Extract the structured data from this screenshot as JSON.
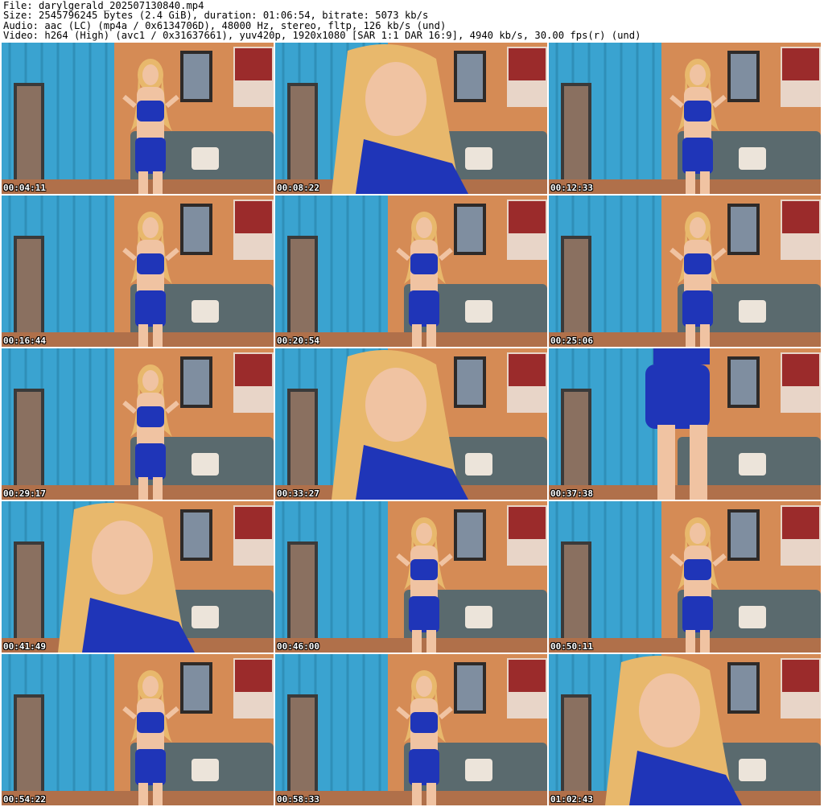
{
  "header": {
    "file": "File: darylgerald_202507130840.mp4",
    "size": "Size: 2545796245 bytes (2.4 GiB), duration: 01:06:54, bitrate: 5073 kb/s",
    "audio": "Audio: aac (LC) (mp4a / 0x6134706D), 48000 Hz, stereo, fltp, 126 kb/s (und)",
    "video": "Video: h264 (High) (avc1 / 0x31637661), yuv420p, 1920x1080 [SAR 1:1 DAR 16:9], 4940 kb/s, 30.00 fps(r) (und)"
  },
  "thumbnails": [
    {
      "timestamp": "00:04:11",
      "shot": "wide"
    },
    {
      "timestamp": "00:08:22",
      "shot": "closeup"
    },
    {
      "timestamp": "00:12:33",
      "shot": "wide"
    },
    {
      "timestamp": "00:16:44",
      "shot": "wide"
    },
    {
      "timestamp": "00:20:54",
      "shot": "wide"
    },
    {
      "timestamp": "00:25:06",
      "shot": "wide"
    },
    {
      "timestamp": "00:29:17",
      "shot": "wide"
    },
    {
      "timestamp": "00:33:27",
      "shot": "closeup"
    },
    {
      "timestamp": "00:37:38",
      "shot": "legs"
    },
    {
      "timestamp": "00:41:49",
      "shot": "closeup"
    },
    {
      "timestamp": "00:46:00",
      "shot": "wide"
    },
    {
      "timestamp": "00:50:11",
      "shot": "wide"
    },
    {
      "timestamp": "00:54:22",
      "shot": "wide"
    },
    {
      "timestamp": "00:58:33",
      "shot": "wide"
    },
    {
      "timestamp": "01:02:43",
      "shot": "closeup"
    }
  ],
  "colors": {
    "curtain": "#3aa3d0",
    "wall": "#d58b55",
    "sofa": "#5a6a6e",
    "outfit": "#1f35b8",
    "hair": "#e8b86c",
    "skin": "#f0c3a2",
    "floor": "#b0704a"
  }
}
